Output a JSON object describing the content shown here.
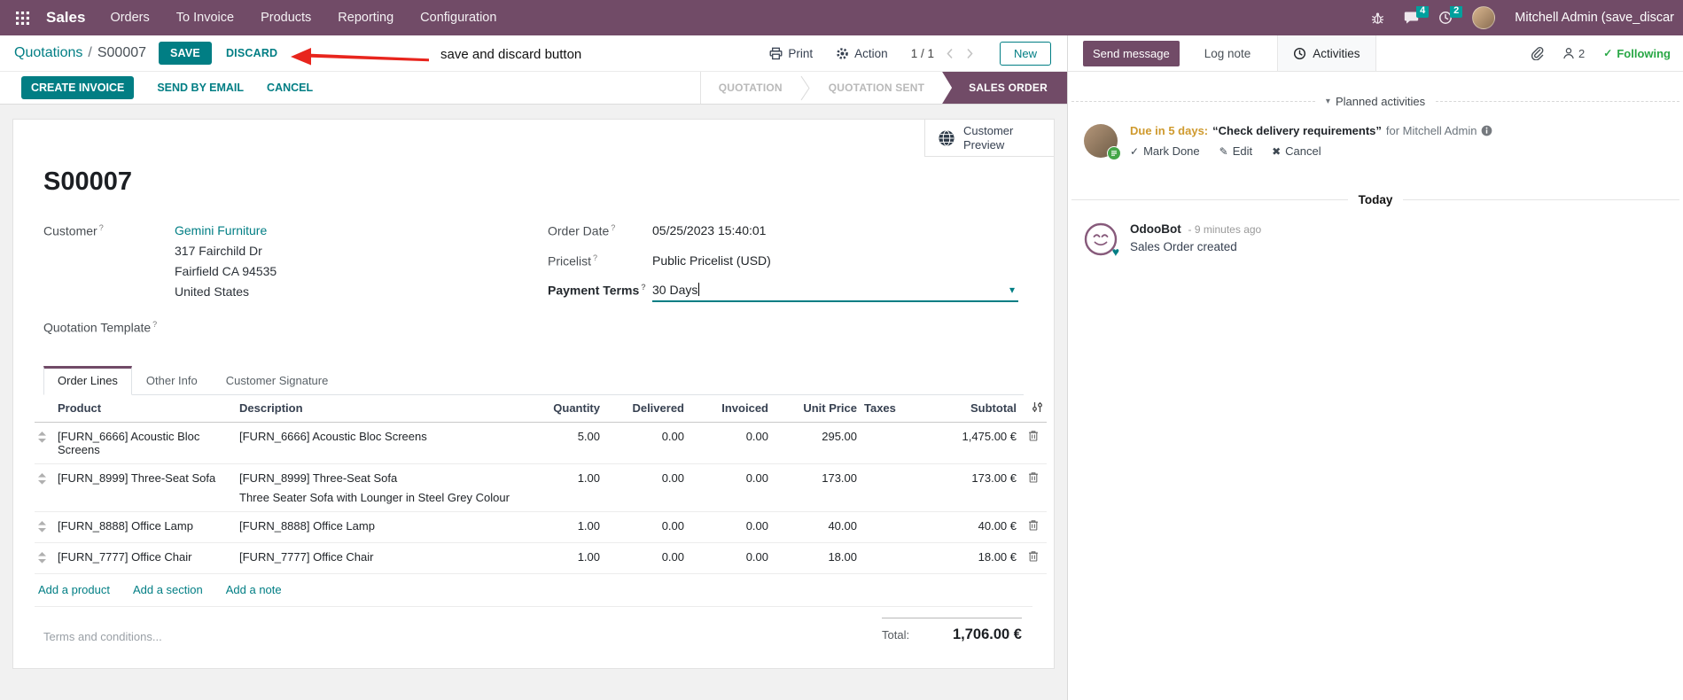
{
  "ui": {
    "help_marker": "?",
    "glyphs": {
      "check": "✓",
      "pencil": "✎",
      "cross": "✖",
      "caret_down": "▾",
      "heart": "♥"
    }
  },
  "navbar": {
    "app_name": "Sales",
    "menus": [
      "Orders",
      "To Invoice",
      "Products",
      "Reporting",
      "Configuration"
    ],
    "message_badge": "4",
    "activity_badge": "2",
    "user_name": "Mitchell Admin (save_discar",
    "bar_color": "#714B67",
    "badge_color": "#00a09d"
  },
  "control_panel": {
    "breadcrumb_parent": "Quotations",
    "breadcrumb_separator": "/",
    "breadcrumb_current": "S00007",
    "save_label": "SAVE",
    "discard_label": "DISCARD",
    "print_label": "Print",
    "action_label": "Action",
    "pager_value": "1 / 1",
    "new_label": "New"
  },
  "annotation": {
    "text": "save and discard button",
    "arrow_color": "#e8251d"
  },
  "status_bar": {
    "create_invoice": "CREATE INVOICE",
    "send_by_email": "SEND BY EMAIL",
    "cancel": "CANCEL",
    "stages": [
      {
        "label": "QUOTATION",
        "active": false
      },
      {
        "label": "QUOTATION SENT",
        "active": false
      },
      {
        "label": "SALES ORDER",
        "active": true
      }
    ],
    "active_color": "#714B67"
  },
  "sheet": {
    "customer_preview": "Customer Preview",
    "title": "S00007",
    "fields": {
      "customer_label": "Customer",
      "customer_name": "Gemini Furniture",
      "customer_address": [
        "317 Fairchild Dr",
        "Fairfield CA 94535",
        "United States"
      ],
      "quotation_template_label": "Quotation Template",
      "order_date_label": "Order Date",
      "order_date_value": "05/25/2023 15:40:01",
      "pricelist_label": "Pricelist",
      "pricelist_value": "Public Pricelist (USD)",
      "payment_terms_label": "Payment Terms",
      "payment_terms_value": "30 Days"
    },
    "tabs": [
      {
        "label": "Order Lines"
      },
      {
        "label": "Other Info"
      },
      {
        "label": "Customer Signature"
      }
    ],
    "order_lines": {
      "headers": {
        "product": "Product",
        "description": "Description",
        "quantity": "Quantity",
        "delivered": "Delivered",
        "invoiced": "Invoiced",
        "unit_price": "Unit Price",
        "taxes": "Taxes",
        "subtotal": "Subtotal"
      },
      "rows": [
        {
          "product": "[FURN_6666] Acoustic Bloc Screens",
          "description": "[FURN_6666] Acoustic Bloc Screens",
          "description2": "",
          "quantity": "5.00",
          "delivered": "0.00",
          "invoiced": "0.00",
          "unit_price": "295.00",
          "taxes": "",
          "subtotal": "1,475.00 €"
        },
        {
          "product": "[FURN_8999] Three-Seat Sofa",
          "description": "[FURN_8999] Three-Seat Sofa",
          "description2": "Three Seater Sofa with Lounger in Steel Grey Colour",
          "quantity": "1.00",
          "delivered": "0.00",
          "invoiced": "0.00",
          "unit_price": "173.00",
          "taxes": "",
          "subtotal": "173.00 €"
        },
        {
          "product": "[FURN_8888] Office Lamp",
          "description": "[FURN_8888] Office Lamp",
          "description2": "",
          "quantity": "1.00",
          "delivered": "0.00",
          "invoiced": "0.00",
          "unit_price": "40.00",
          "taxes": "",
          "subtotal": "40.00 €"
        },
        {
          "product": "[FURN_7777] Office Chair",
          "description": "[FURN_7777] Office Chair",
          "description2": "",
          "quantity": "1.00",
          "delivered": "0.00",
          "invoiced": "0.00",
          "unit_price": "18.00",
          "taxes": "",
          "subtotal": "18.00 €"
        }
      ],
      "add_product": "Add a product",
      "add_section": "Add a section",
      "add_note": "Add a note"
    },
    "terms_placeholder": "Terms and conditions...",
    "total_label": "Total:",
    "total_value": "1,706.00 €"
  },
  "chatter": {
    "send_message": "Send message",
    "log_note": "Log note",
    "activities_label": "Activities",
    "followers_count": "2",
    "following_label": "Following",
    "planned_header": "Planned activities",
    "activity": {
      "due_text": "Due in 5 days:",
      "summary": "“Check delivery requirements”",
      "assignee_text": "for Mitchell Admin",
      "mark_done": "Mark Done",
      "edit": "Edit",
      "cancel": "Cancel"
    },
    "today_separator": "Today",
    "message": {
      "author": "OdooBot",
      "timestamp": "- 9 minutes ago",
      "body": "Sales Order created"
    }
  }
}
